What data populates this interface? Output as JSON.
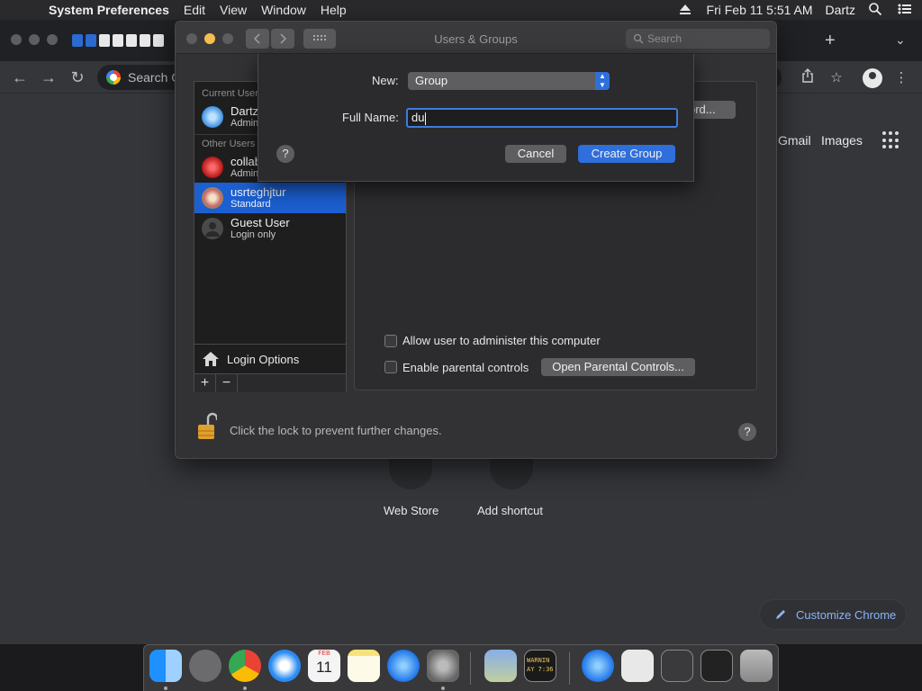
{
  "menubar": {
    "app_name": "System Preferences",
    "menus": [
      "Edit",
      "View",
      "Window",
      "Help"
    ],
    "datetime": "Fri Feb 11  5:51 AM",
    "user": "Dartz"
  },
  "chrome": {
    "omnibox_text": "Search G",
    "links": {
      "gmail": "Gmail",
      "images": "Images"
    },
    "shortcuts": [
      "Web Store",
      "Add shortcut"
    ],
    "customize_label": "Customize Chrome"
  },
  "prefs": {
    "title": "Users & Groups",
    "search_placeholder": "Search",
    "sections": {
      "current": "Current User",
      "other": "Other Users"
    },
    "users": [
      {
        "name": "Dartz",
        "role": "Admin"
      },
      {
        "name": "collab",
        "role": "Admin"
      },
      {
        "name": "usrteghjtur",
        "role": "Standard"
      },
      {
        "name": "Guest User",
        "role": "Login only"
      }
    ],
    "login_options": "Login Options",
    "add_symbol": "+",
    "remove_symbol": "−",
    "password_button_fragment": "ord...",
    "allow_admin_label": "Allow user to administer this computer",
    "parental_label": "Enable parental controls",
    "open_parental_button": "Open Parental Controls...",
    "lock_text": "Click the lock to prevent further changes.",
    "help_symbol": "?"
  },
  "sheet": {
    "new_label": "New:",
    "new_value": "Group",
    "fullname_label": "Full Name:",
    "fullname_value": "du",
    "cancel_label": "Cancel",
    "create_label": "Create Group",
    "help_symbol": "?"
  },
  "dock": {
    "calendar_month": "FEB",
    "calendar_day": "11",
    "console_text": "WARNIN\nAY 7:36"
  },
  "colors": {
    "accent": "#1b5fd0",
    "chrome_link": "#8ab4f8"
  }
}
